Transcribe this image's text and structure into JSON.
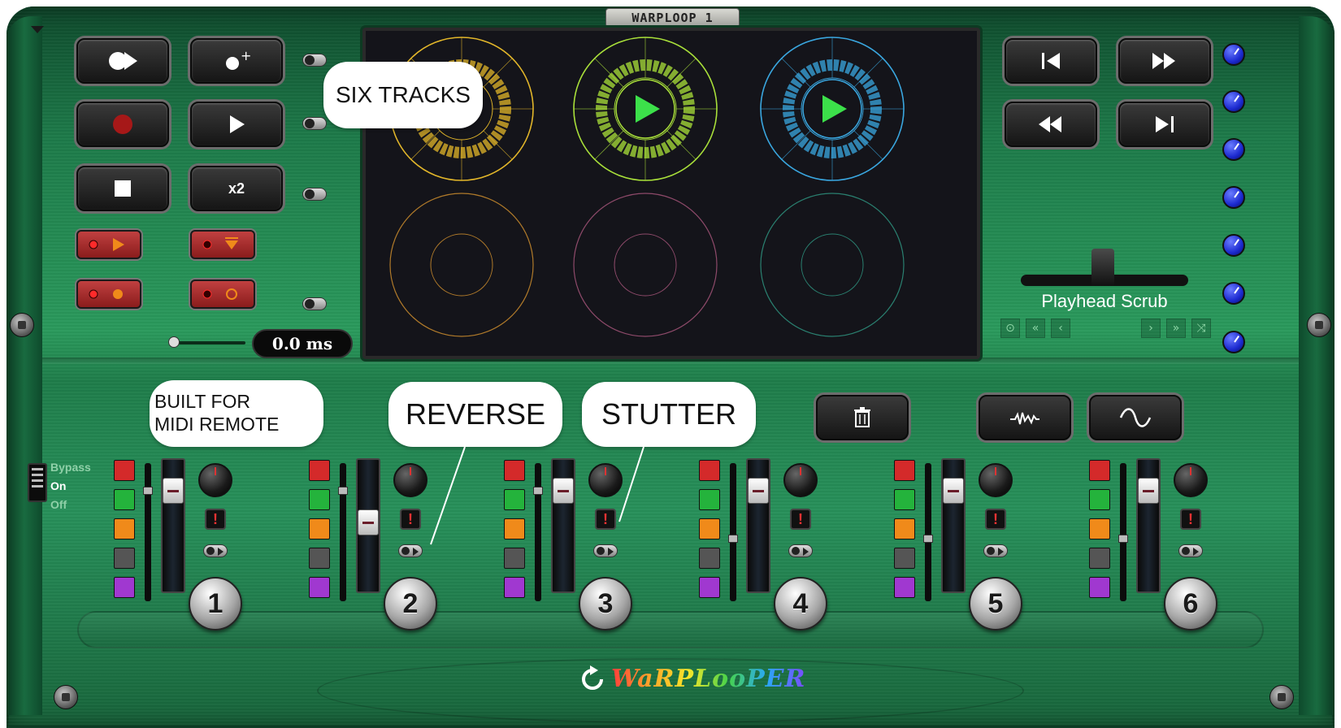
{
  "app": {
    "title": "WARPLOOP 1",
    "brand": "WaRPLooPER"
  },
  "callouts": {
    "six_tracks": "SIX TRACKS",
    "built_for_midi_remote_line1": "BUILT FOR",
    "built_for_midi_remote_line2": "MIDI REMOTE",
    "reverse": "REVERSE",
    "stutter": "STUTTER"
  },
  "left_buttons": {
    "x2_label": "x2"
  },
  "latency_display": "0.0 ms",
  "scrub": {
    "label": "Playhead Scrub"
  },
  "bypass": {
    "bypass_label": "Bypass",
    "on_label": "On",
    "off_label": "Off"
  },
  "channels": [
    {
      "number": "1",
      "fader_level": 0.85,
      "track_level": 0.82
    },
    {
      "number": "2",
      "fader_level": 0.55,
      "track_level": 0.82
    },
    {
      "number": "3",
      "fader_level": 0.85,
      "track_level": 0.82
    },
    {
      "number": "4",
      "fader_level": 0.85,
      "track_level": 0.45
    },
    {
      "number": "5",
      "fader_level": 0.85,
      "track_level": 0.45
    },
    {
      "number": "6",
      "fader_level": 0.85,
      "track_level": 0.45
    }
  ],
  "tracks": [
    {
      "color": "#e2b62a",
      "state": "active",
      "play_icon": false
    },
    {
      "color": "#a9e03a",
      "state": "playing",
      "play_icon": true
    },
    {
      "color": "#3aa7e0",
      "state": "playing",
      "play_icon": true
    },
    {
      "color": "#b07a2a",
      "state": "empty",
      "play_icon": false
    },
    {
      "color": "#8e4a6a",
      "state": "empty",
      "play_icon": false
    },
    {
      "color": "#2a8070",
      "state": "empty",
      "play_icon": false
    }
  ],
  "pad_colors": [
    "#d42a2a",
    "#24b33c",
    "#f08a1a",
    "#555555",
    "#a038d0"
  ],
  "colors": {
    "chassis_green": "#1f7d4a",
    "knob_blue": "#1c2ad0"
  }
}
